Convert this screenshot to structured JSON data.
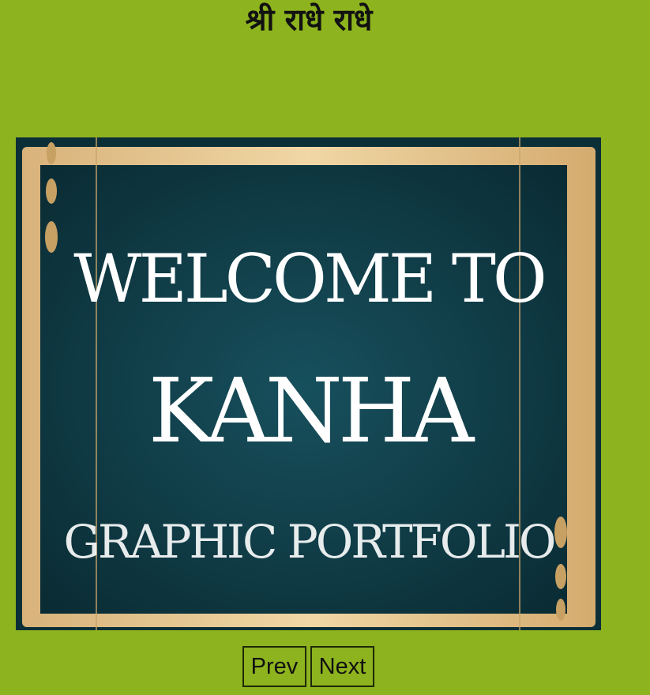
{
  "header": {
    "title": "श्री राधे राधे"
  },
  "slide": {
    "line1": "WELCOME TO",
    "line2": "KANHA",
    "line3": "GRAPHIC PORTFOLIO",
    "colors": {
      "board": "#0f3a45",
      "frame": "#e3c48e",
      "text": "#ffffff"
    }
  },
  "controls": {
    "prev_label": "Prev",
    "next_label": "Next"
  },
  "theme": {
    "background": "#8db31e"
  }
}
